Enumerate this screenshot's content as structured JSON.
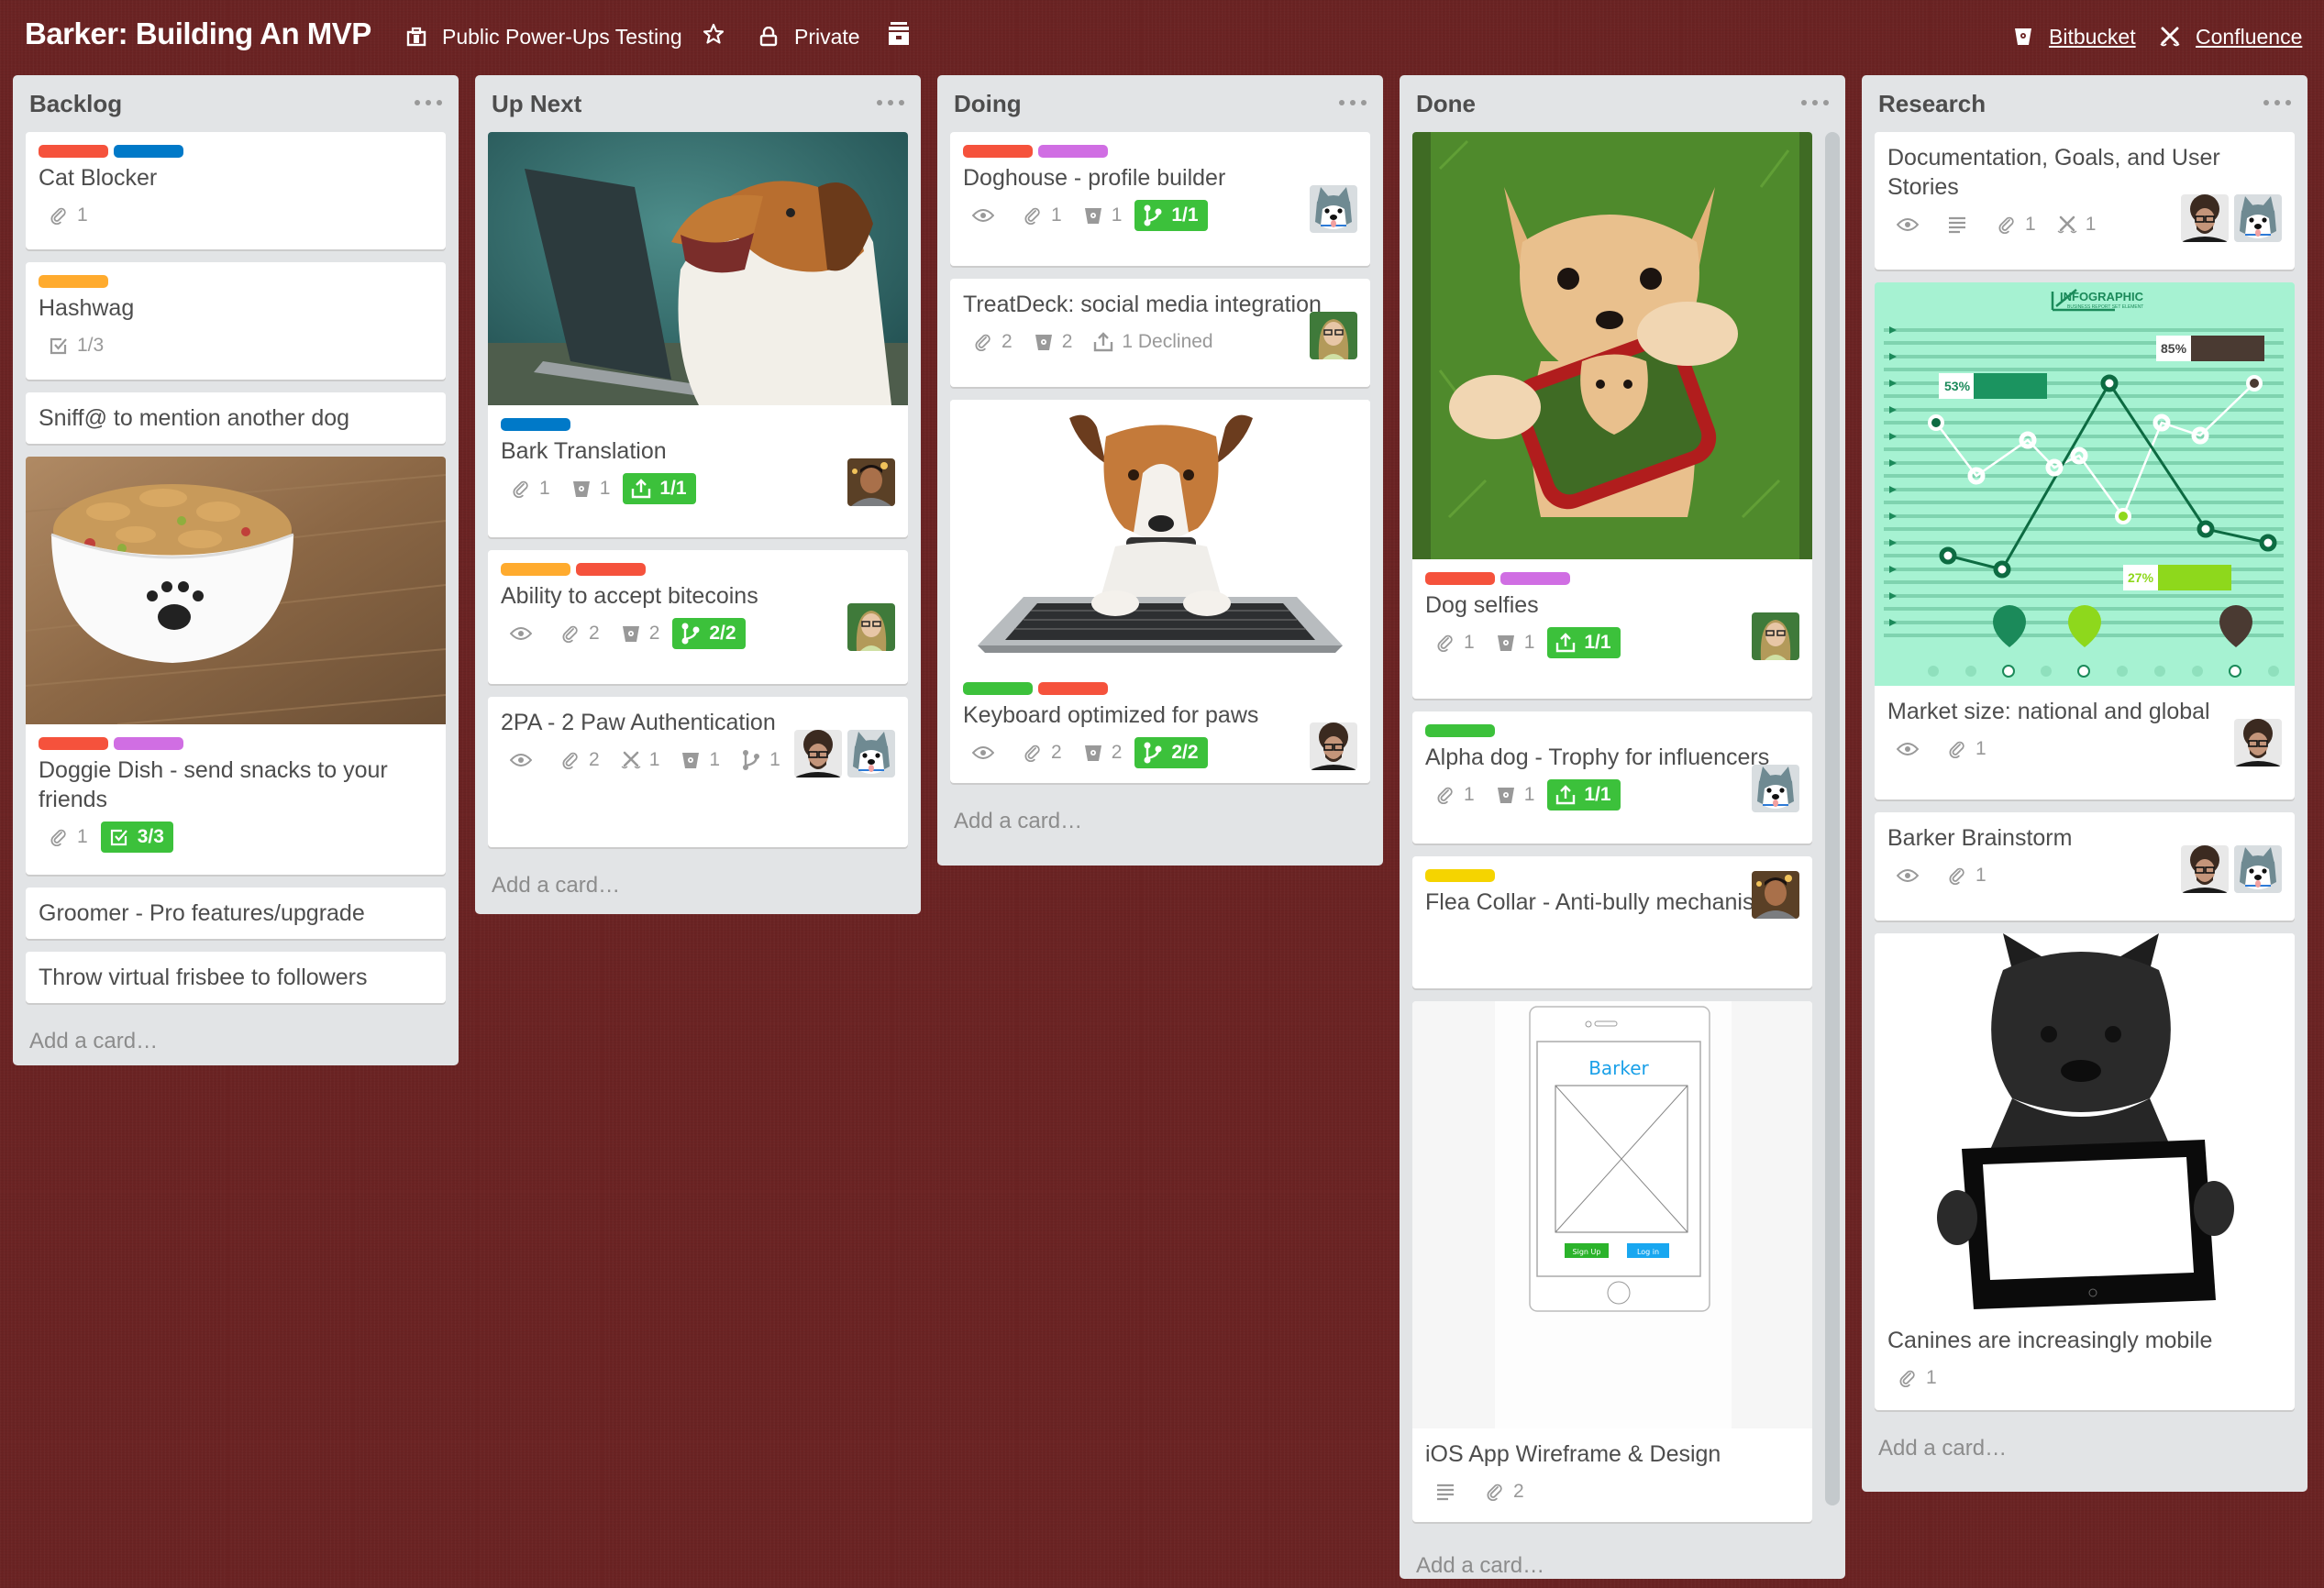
{
  "header": {
    "board_title": "Barker: Building An MVP",
    "team": "Public Power-Ups Testing",
    "team_icon": "team-icon",
    "star_icon": "star-icon",
    "visibility": "Private",
    "visibility_icon": "lock-icon",
    "archive_icon": "archive-icon",
    "powerups": [
      {
        "label": "Bitbucket",
        "icon": "bitbucket-icon"
      },
      {
        "label": "Confluence",
        "icon": "confluence-icon"
      }
    ]
  },
  "colors": {
    "board_bg": "#6b2323",
    "list_bg": "#e2e4e6",
    "label_red": "#f5523c",
    "label_blue": "#0079c8",
    "label_orange": "#ffab2e",
    "label_purple": "#d06ee3",
    "label_green": "#3cc13b",
    "label_yellow": "#f5d400",
    "badge_green": "#3cc13b"
  },
  "add_card_label": "Add a card…",
  "lists": [
    {
      "title": "Backlog",
      "cards": [
        {
          "title": "Cat Blocker",
          "labels": [
            "red",
            "blue"
          ],
          "badges": [
            {
              "icon": "attachment-icon",
              "text": "1"
            }
          ]
        },
        {
          "title": "Hashwag",
          "labels": [
            "orange"
          ],
          "badges": [
            {
              "icon": "checklist-icon",
              "text": "1/3"
            }
          ]
        },
        {
          "title": "Sniff@ to mention another dog",
          "labels": [],
          "badges": []
        },
        {
          "title": "Doggie Dish - send snacks to your friends",
          "cover": "dog-treats-bowl-image",
          "labels": [
            "red",
            "purple"
          ],
          "badges": [
            {
              "icon": "attachment-icon",
              "text": "1"
            },
            {
              "icon": "checklist-icon",
              "text": "3/3",
              "complete": true
            }
          ]
        },
        {
          "title": "Groomer - Pro features/upgrade",
          "labels": [],
          "badges": []
        },
        {
          "title": "Throw virtual frisbee to followers",
          "labels": [],
          "badges": []
        }
      ]
    },
    {
      "title": "Up Next",
      "cards": [
        {
          "title": "Bark Translation",
          "cover": "yawning-beagle-laptop-image",
          "labels": [
            "blue"
          ],
          "badges": [
            {
              "icon": "attachment-icon",
              "text": "1"
            },
            {
              "icon": "bitbucket-icon",
              "text": "1"
            },
            {
              "icon": "pull-request-icon",
              "text": "1/1",
              "complete": true
            }
          ],
          "members": [
            "member-man"
          ]
        },
        {
          "title": "Ability to accept bitecoins",
          "labels": [
            "orange",
            "red"
          ],
          "badges": [
            {
              "icon": "watch-icon",
              "text": ""
            },
            {
              "icon": "attachment-icon",
              "text": "2"
            },
            {
              "icon": "bitbucket-icon",
              "text": "2"
            },
            {
              "icon": "branch-icon",
              "text": "2/2",
              "complete": true
            }
          ],
          "members": [
            "member-woman"
          ]
        },
        {
          "title": "2PA - 2 Paw Authentication",
          "labels": [],
          "badges": [
            {
              "icon": "watch-icon",
              "text": ""
            },
            {
              "icon": "attachment-icon",
              "text": "2"
            },
            {
              "icon": "confluence-icon",
              "text": "1"
            },
            {
              "icon": "bitbucket-icon",
              "text": "1"
            },
            {
              "icon": "branch-icon",
              "text": "1"
            }
          ],
          "members": [
            "member-curly",
            "member-husky"
          ]
        }
      ]
    },
    {
      "title": "Doing",
      "cards": [
        {
          "title": "Doghouse - profile builder",
          "labels": [
            "red",
            "purple"
          ],
          "badges": [
            {
              "icon": "watch-icon",
              "text": ""
            },
            {
              "icon": "attachment-icon",
              "text": "1"
            },
            {
              "icon": "bitbucket-icon",
              "text": "1"
            },
            {
              "icon": "branch-icon",
              "text": "1/1",
              "complete": true
            }
          ],
          "members": [
            "member-husky"
          ]
        },
        {
          "title": "TreatDeck: social media integration",
          "labels": [],
          "badges": [
            {
              "icon": "attachment-icon",
              "text": "2"
            },
            {
              "icon": "bitbucket-icon",
              "text": "2"
            },
            {
              "icon": "pull-request-icon",
              "text": "1 Declined"
            }
          ],
          "members": [
            "member-woman"
          ]
        },
        {
          "title": "Keyboard optimized for paws",
          "cover": "dog-keyboard-image",
          "labels": [
            "green",
            "red"
          ],
          "badges": [
            {
              "icon": "watch-icon",
              "text": ""
            },
            {
              "icon": "attachment-icon",
              "text": "2"
            },
            {
              "icon": "bitbucket-icon",
              "text": "2"
            },
            {
              "icon": "branch-icon",
              "text": "2/2",
              "complete": true
            }
          ],
          "members": [
            "member-curly"
          ]
        }
      ]
    },
    {
      "title": "Done",
      "cards": [
        {
          "title": "Dog selfies",
          "cover": "chihuahua-selfie-image",
          "labels": [
            "red",
            "purple"
          ],
          "badges": [
            {
              "icon": "attachment-icon",
              "text": "1"
            },
            {
              "icon": "bitbucket-icon",
              "text": "1"
            },
            {
              "icon": "pull-request-icon",
              "text": "1/1",
              "complete": true
            }
          ],
          "members": [
            "member-woman"
          ]
        },
        {
          "title": "Alpha dog - Trophy for influencers",
          "labels": [
            "green"
          ],
          "badges": [
            {
              "icon": "attachment-icon",
              "text": "1"
            },
            {
              "icon": "bitbucket-icon",
              "text": "1"
            },
            {
              "icon": "pull-request-icon",
              "text": "1/1",
              "complete": true
            }
          ],
          "members": [
            "member-husky"
          ]
        },
        {
          "title": "Flea Collar - Anti-bully mechanisms",
          "labels": [
            "yellow"
          ],
          "badges": [],
          "members": [
            "member-man"
          ]
        },
        {
          "title": "iOS App Wireframe & Design",
          "cover": "wireframe-image",
          "cover_text": {
            "app_name": "Barker",
            "signup": "Sign Up",
            "login": "Log in"
          },
          "labels": [],
          "badges": [
            {
              "icon": "description-icon",
              "text": ""
            },
            {
              "icon": "attachment-icon",
              "text": "2"
            }
          ]
        }
      ]
    },
    {
      "title": "Research",
      "cards": [
        {
          "title": "Documentation, Goals, and User Stories",
          "labels": [],
          "badges": [
            {
              "icon": "watch-icon",
              "text": ""
            },
            {
              "icon": "description-icon",
              "text": ""
            },
            {
              "icon": "attachment-icon",
              "text": "1"
            },
            {
              "icon": "confluence-icon",
              "text": "1"
            }
          ],
          "members": [
            "member-curly",
            "member-husky"
          ]
        },
        {
          "title": "Market size: national and global",
          "cover": "infographic-image",
          "cover_text": {
            "heading": "INFOGRAPHIC",
            "sub": "BUSINESS REPORT SET ELEMENT",
            "stat1": "53%",
            "stat2": "85%",
            "stat3": "27%"
          },
          "labels": [],
          "badges": [
            {
              "icon": "watch-icon",
              "text": ""
            },
            {
              "icon": "attachment-icon",
              "text": "1"
            }
          ],
          "members": [
            "member-curly"
          ]
        },
        {
          "title": "Barker Brainstorm",
          "labels": [],
          "badges": [
            {
              "icon": "watch-icon",
              "text": ""
            },
            {
              "icon": "attachment-icon",
              "text": "1"
            }
          ],
          "members": [
            "member-curly",
            "member-husky"
          ]
        },
        {
          "title": "Canines are increasingly mobile",
          "cover": "bulldog-tablet-image",
          "labels": [],
          "badges": [
            {
              "icon": "attachment-icon",
              "text": "1"
            }
          ]
        }
      ]
    }
  ]
}
